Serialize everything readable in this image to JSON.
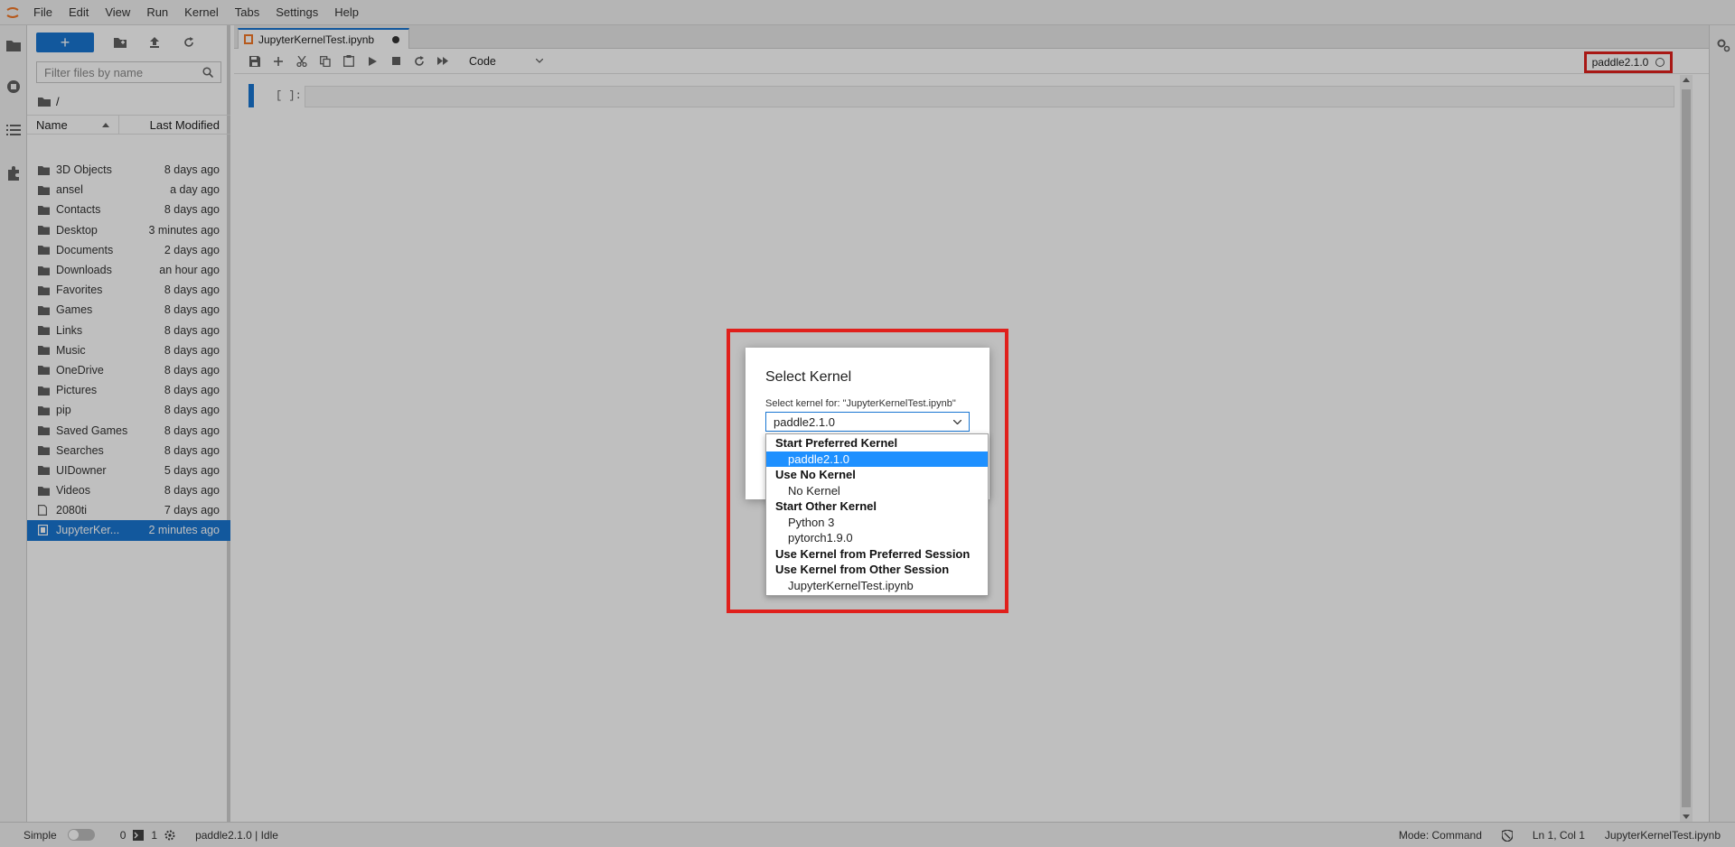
{
  "menubar": {
    "items": [
      "File",
      "Edit",
      "View",
      "Run",
      "Kernel",
      "Tabs",
      "Settings",
      "Help"
    ]
  },
  "filebrowser": {
    "new_label": "+",
    "filter_placeholder": "Filter files by name",
    "breadcrumb": "/",
    "header_name": "Name",
    "header_modified": "Last Modified",
    "files": [
      {
        "name": "3D Objects",
        "modified": "8 days ago",
        "type": "folder"
      },
      {
        "name": "ansel",
        "modified": "a day ago",
        "type": "folder"
      },
      {
        "name": "Contacts",
        "modified": "8 days ago",
        "type": "folder"
      },
      {
        "name": "Desktop",
        "modified": "3 minutes ago",
        "type": "folder"
      },
      {
        "name": "Documents",
        "modified": "2 days ago",
        "type": "folder"
      },
      {
        "name": "Downloads",
        "modified": "an hour ago",
        "type": "folder"
      },
      {
        "name": "Favorites",
        "modified": "8 days ago",
        "type": "folder"
      },
      {
        "name": "Games",
        "modified": "8 days ago",
        "type": "folder"
      },
      {
        "name": "Links",
        "modified": "8 days ago",
        "type": "folder"
      },
      {
        "name": "Music",
        "modified": "8 days ago",
        "type": "folder"
      },
      {
        "name": "OneDrive",
        "modified": "8 days ago",
        "type": "folder"
      },
      {
        "name": "Pictures",
        "modified": "8 days ago",
        "type": "folder"
      },
      {
        "name": "pip",
        "modified": "8 days ago",
        "type": "folder"
      },
      {
        "name": "Saved Games",
        "modified": "8 days ago",
        "type": "folder"
      },
      {
        "name": "Searches",
        "modified": "8 days ago",
        "type": "folder"
      },
      {
        "name": "UIDowner",
        "modified": "5 days ago",
        "type": "folder"
      },
      {
        "name": "Videos",
        "modified": "8 days ago",
        "type": "folder"
      },
      {
        "name": "2080ti",
        "modified": "7 days ago",
        "type": "file"
      },
      {
        "name": "JupyterKer...",
        "modified": "2 minutes ago",
        "type": "notebook",
        "selected": true
      }
    ]
  },
  "notebook": {
    "tab_label": "JupyterKernelTest.ipynb",
    "cell_type": "Code",
    "kernel_name": "paddle2.1.0",
    "cell_prompt": "[ ]:"
  },
  "dialog": {
    "title": "Select Kernel",
    "prompt": "Select kernel for: \"JupyterKernelTest.ipynb\"",
    "selected_value": "paddle2.1.0"
  },
  "dropdown": {
    "groups": [
      {
        "label": "Start Preferred Kernel",
        "options": [
          {
            "label": "paddle2.1.0",
            "selected": true
          }
        ]
      },
      {
        "label": "Use No Kernel",
        "options": [
          {
            "label": "No Kernel"
          }
        ]
      },
      {
        "label": "Start Other Kernel",
        "options": [
          {
            "label": "Python 3"
          },
          {
            "label": "pytorch1.9.0"
          }
        ]
      },
      {
        "label": "Use Kernel from Preferred Session",
        "options": []
      },
      {
        "label": "Use Kernel from Other Session",
        "options": [
          {
            "label": "JupyterKernelTest.ipynb"
          }
        ]
      }
    ]
  },
  "statusbar": {
    "mode_label": "Simple",
    "terminals_count": "0",
    "kernels_count": "1",
    "kernel_status": "paddle2.1.0 | Idle",
    "mode": "Mode: Command",
    "cursor": "Ln 1, Col 1",
    "filename": "JupyterKernelTest.ipynb"
  },
  "colors": {
    "accent": "#1976d2",
    "highlight": "#e0201c",
    "selected_option": "#1e90ff"
  }
}
